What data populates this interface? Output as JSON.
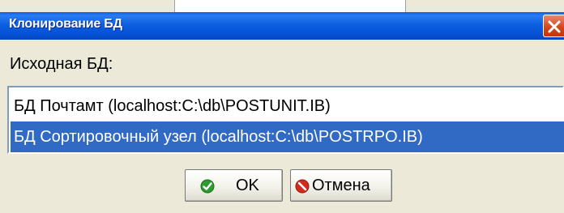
{
  "dialog": {
    "title": "Клонирование БД",
    "source_label": "Исходная БД:",
    "databases": [
      {
        "label": "БД Почтамт (localhost:C:\\db\\POSTUNIT.IB)",
        "selected": false
      },
      {
        "label": "БД Сортировочный узел (localhost:C:\\db\\POSTRPO.IB)",
        "selected": true
      }
    ],
    "buttons": {
      "ok": {
        "label": "OK",
        "icon": "green-check-icon"
      },
      "cancel": {
        "label": "Отмена",
        "icon": "red-no-entry-icon"
      }
    },
    "colors": {
      "titlebar": "#0651d6",
      "selection": "#316ac5",
      "face": "#ece9d8"
    }
  }
}
